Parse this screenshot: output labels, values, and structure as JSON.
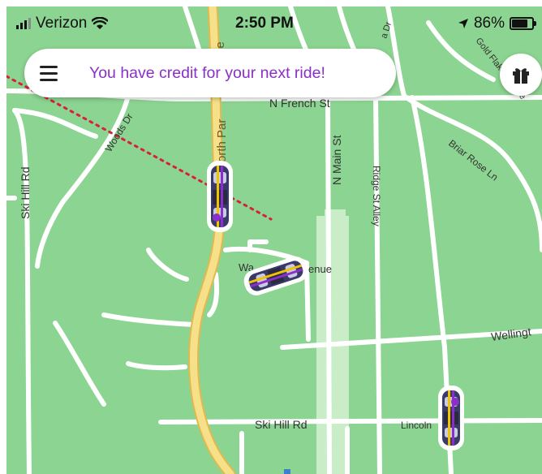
{
  "status_bar": {
    "carrier": "Verizon",
    "time": "2:50 PM",
    "battery": "86%",
    "battery_level": 0.86
  },
  "banner": {
    "text": "You have credit for your next ride!"
  },
  "map": {
    "street_labels": {
      "n_french_st": "N French St",
      "north_park": "orth Par",
      "park_ue": "ue",
      "woods_dr": "Woods Dr",
      "ski_hill_rd_vertical": "Ski Hill Rd",
      "n_main_st": "N Main St",
      "ridge_st_alley": "Ridge St Alley",
      "briar_rose_ln": "Briar Rose Ln",
      "gold_flake_terrace": "Gold Flake Terrace",
      "wa_partial": "Wa",
      "enue_partial": "enue",
      "wellington_partial": "Wellingt",
      "ski_hill_rd_horizontal": "Ski Hill Rd",
      "lincoln_partial": "Lincoln",
      "dr_partial": "a Dr"
    },
    "cars": [
      {
        "id": "car-1",
        "heading_deg": 0
      },
      {
        "id": "car-2",
        "heading_deg": 72
      },
      {
        "id": "car-3",
        "heading_deg": 0
      }
    ]
  },
  "colors": {
    "map_green": "#8cd491",
    "road": "#ffffff",
    "highway": "#f7e08a",
    "highway_edge": "#e2b94e",
    "accent_purple": "#8a2fc9",
    "route_dots": "#d81f3c"
  },
  "icons": {
    "menu": "hamburger-icon",
    "gift": "gift-icon",
    "wifi": "wifi-icon",
    "location": "location-arrow-icon",
    "battery": "battery-icon",
    "signal": "signal-bars-icon"
  }
}
